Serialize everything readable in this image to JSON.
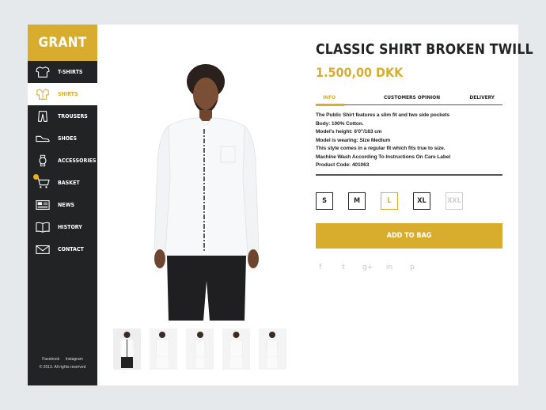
{
  "brand": {
    "logo_text": "GRANT"
  },
  "sidebar": {
    "items": [
      {
        "label": "T-SHIRTS",
        "icon": "tshirt-icon",
        "active": false
      },
      {
        "label": "SHIRTS",
        "icon": "shirt-icon",
        "active": true
      },
      {
        "label": "TROUSERS",
        "icon": "trousers-icon",
        "active": false
      },
      {
        "label": "SHOES",
        "icon": "shoe-icon",
        "active": false
      },
      {
        "label": "ACCESSORIES",
        "icon": "watch-icon",
        "active": false
      },
      {
        "label": "BASKET",
        "icon": "cart-icon",
        "active": false
      },
      {
        "label": "NEWS",
        "icon": "news-icon",
        "active": false
      },
      {
        "label": "HISTORY",
        "icon": "book-icon",
        "active": false
      },
      {
        "label": "CONTACT",
        "icon": "envelope-icon",
        "active": false
      }
    ],
    "footer": {
      "facebook": "Facebook",
      "instagram": "Instagram",
      "copyright": "© 2013. All rights reserved"
    }
  },
  "product": {
    "title": "CLASSIC SHIRT BROKEN TWILL",
    "price": "1.500,00 DKK",
    "tabs": [
      {
        "label": "INFO",
        "active": true
      },
      {
        "label": "CUSTOMERS OPINION",
        "active": false
      },
      {
        "label": "DELIVERY",
        "active": false
      }
    ],
    "description": [
      "The Public Shirt features a slim fit and two side pockets",
      "Body: 100% Cotton.",
      "Model's height: 6'0\"/183 cm",
      "Model is wearing: Size Medium",
      "This style comes in a regular fit which fits true to size.",
      "Machine Wash According To Instructions On Care Label",
      "Product Code: 401063"
    ],
    "sizes": [
      {
        "label": "S",
        "state": "normal"
      },
      {
        "label": "M",
        "state": "normal"
      },
      {
        "label": "L",
        "state": "selected"
      },
      {
        "label": "XL",
        "state": "normal"
      },
      {
        "label": "XXL",
        "state": "disabled"
      }
    ],
    "add_to_bag": "ADD TO BAG",
    "social": [
      {
        "glyph": "f",
        "icon": "facebook-icon"
      },
      {
        "glyph": "t",
        "icon": "twitter-icon"
      },
      {
        "glyph": "g+",
        "icon": "google-plus-icon"
      },
      {
        "glyph": "in",
        "icon": "linkedin-icon"
      },
      {
        "glyph": "p",
        "icon": "pinterest-icon"
      }
    ],
    "thumbnails": 5
  },
  "colors": {
    "accent": "#d8ad2d",
    "sidebar_bg": "#222325",
    "page_bg": "#e5e9ec"
  }
}
